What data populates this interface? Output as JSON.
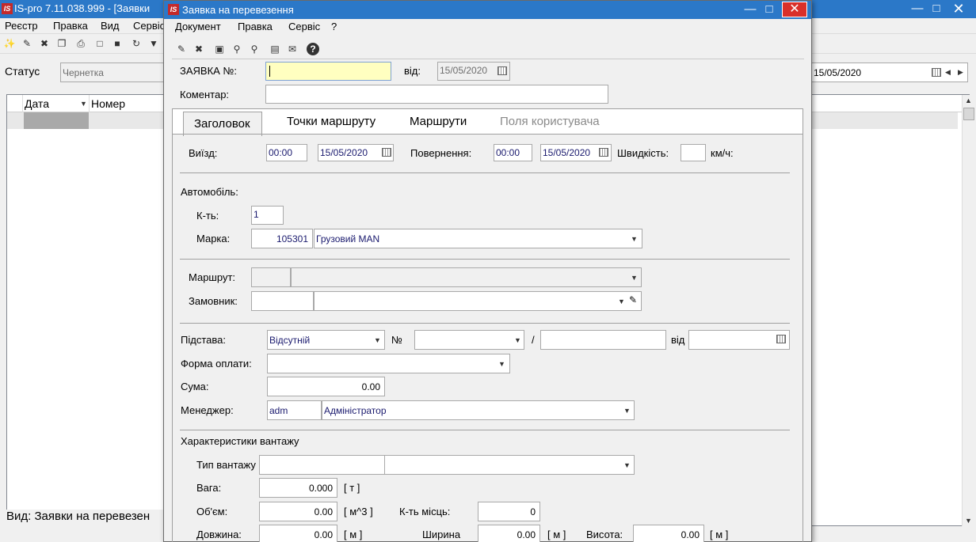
{
  "main_window": {
    "title": "IS-pro 7.11.038.999 - [Заявки",
    "logo_text": "IS",
    "menu": [
      "Реєстр",
      "Правка",
      "Вид",
      "Сервіс"
    ],
    "status_label": "Статус",
    "status_value": "Чернетка",
    "date_value": "15/05/2020",
    "columns": [
      "Дата",
      "Номер"
    ],
    "footer_text": "Вид: Заявки на перевезен"
  },
  "dialog": {
    "title": "Заявка на перевезення",
    "logo_text": "IS",
    "menu": [
      "Документ",
      "Правка",
      "Сервіс",
      "?"
    ],
    "request_no_label": "ЗАЯВКА №:",
    "request_no_value": "",
    "from_label": "від:",
    "from_date": "15/05/2020",
    "comment_label": "Коментар:",
    "comment_value": "",
    "tabs": [
      "Заголовок",
      "Точки маршруту",
      "Маршрути",
      "Поля користувача"
    ],
    "departure_label": "Виїзд:",
    "departure_time": "00:00",
    "departure_date": "15/05/2020",
    "return_label": "Повернення:",
    "return_time": "00:00",
    "return_date": "15/05/2020",
    "speed_label": "Швидкість:",
    "speed_value": "",
    "speed_unit": "км/ч:",
    "car_label": "Автомобіль:",
    "qty_label": "К-ть:",
    "qty_value": "1",
    "brand_label": "Марка:",
    "brand_code": "105301",
    "brand_name": "Грузовий MAN",
    "route_label": "Маршрут:",
    "customer_label": "Замовник:",
    "basis_label": "Підстава:",
    "basis_value": "Відсутній",
    "number_label": "№",
    "slash": "/",
    "basis_from_label": "від",
    "payment_label": "Форма оплати:",
    "payment_value": "",
    "sum_label": "Сума:",
    "sum_value": "0.00",
    "manager_label": "Менеджер:",
    "manager_code": "adm",
    "manager_name": "Адміністратор",
    "cargo_section": "Характеристики вантажу",
    "cargo_type_label": "Тип вантажу",
    "weight_label": "Вага:",
    "weight_value": "0.000",
    "weight_unit": "[ т ]",
    "volume_label": "Об'єм:",
    "volume_value": "0.00",
    "volume_unit": "[ м^3 ]",
    "places_label": "К-ть місць:",
    "places_value": "0",
    "length_label": "Довжина:",
    "length_value": "0.00",
    "length_unit": "[ м ]",
    "width_label": "Ширина",
    "width_value": "0.00",
    "width_unit": "[ м ]",
    "height_label": "Висота:",
    "height_value": "0.00",
    "height_unit": "[ м ]"
  },
  "icons": {
    "minimize": "minimize-icon",
    "maximize": "maximize-icon",
    "close": "close-icon",
    "dropdown": "chevron-down-icon",
    "calendar": "calendar-icon"
  },
  "colors": {
    "titlebar": "#2b78c8",
    "close": "#d9302a",
    "active_input": "#ffffc0"
  }
}
